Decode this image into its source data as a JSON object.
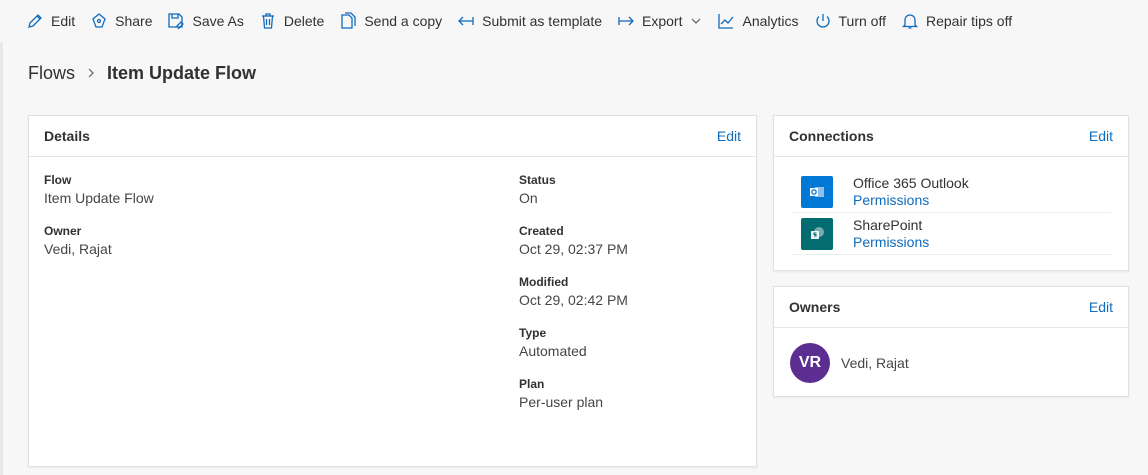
{
  "toolbar": {
    "items": [
      {
        "label": "Edit",
        "icon": "pencil-icon"
      },
      {
        "label": "Share",
        "icon": "share-icon"
      },
      {
        "label": "Save As",
        "icon": "save-as-icon"
      },
      {
        "label": "Delete",
        "icon": "trash-icon"
      },
      {
        "label": "Send a copy",
        "icon": "copy-icon"
      },
      {
        "label": "Submit as template",
        "icon": "submit-arrow-icon"
      },
      {
        "label": "Export",
        "icon": "export-arrow-icon"
      },
      {
        "label": "Analytics",
        "icon": "analytics-icon"
      },
      {
        "label": "Turn off",
        "icon": "power-icon"
      },
      {
        "label": "Repair tips off",
        "icon": "bell-icon"
      }
    ]
  },
  "breadcrumb": {
    "root": "Flows",
    "current": "Item Update Flow"
  },
  "details": {
    "title": "Details",
    "edit_label": "Edit",
    "flow_label": "Flow",
    "flow_value": "Item Update Flow",
    "owner_label": "Owner",
    "owner_value": "Vedi, Rajat",
    "status_label": "Status",
    "status_value": "On",
    "created_label": "Created",
    "created_value": "Oct 29, 02:37 PM",
    "modified_label": "Modified",
    "modified_value": "Oct 29, 02:42 PM",
    "type_label": "Type",
    "type_value": "Automated",
    "plan_label": "Plan",
    "plan_value": "Per-user plan"
  },
  "connections": {
    "title": "Connections",
    "edit_label": "Edit",
    "items": [
      {
        "name": "Office 365 Outlook",
        "permissions": "Permissions",
        "icon": "outlook-icon",
        "color": "#0078d4"
      },
      {
        "name": "SharePoint",
        "permissions": "Permissions",
        "icon": "sharepoint-icon",
        "color": "#036c70"
      }
    ]
  },
  "owners": {
    "title": "Owners",
    "edit_label": "Edit",
    "items": [
      {
        "initials": "VR",
        "name": "Vedi, Rajat",
        "color": "#5c2e91"
      }
    ]
  },
  "colors": {
    "accent": "#0f6cbd",
    "text": "#323130"
  }
}
